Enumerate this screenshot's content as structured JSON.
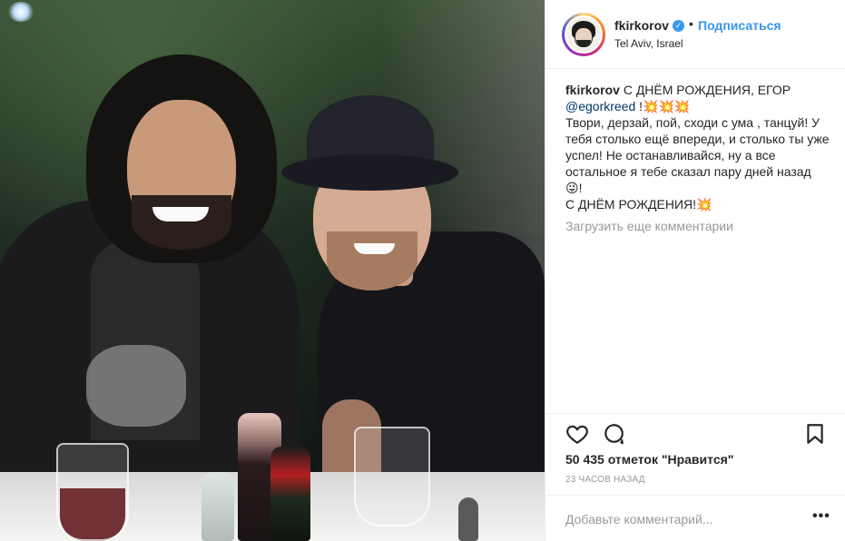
{
  "post": {
    "image_alt": "Two men posing at a table",
    "username": "fkirkorov",
    "follow_label": "Подписаться",
    "location": "Tel Aviv, Israel",
    "caption": {
      "username": "fkirkorov",
      "line1": "С ДНЁМ РОЖДЕНИЯ, ЕГОР",
      "mention": "@egorkreed",
      "line2_suffix": " !💥💥💥",
      "body": "Твори, дерзай, пой, сходи с ума , танцуй! У тебя столько ещё впереди, и столько ты уже успел! Не останавливайся, ну а все остальное я тебе сказал пару дней назад",
      "emoji_suffix": "😜!",
      "closing": "С ДНЁМ РОЖДЕНИЯ!💥"
    },
    "load_more_label": "Загрузить еще комментарии",
    "likes_text": "50 435 отметок \"Нравится\"",
    "time_text": "23 ЧАСОВ НАЗАД",
    "comment_placeholder": "Добавьте комментарий...",
    "more_label": "•••"
  },
  "icons": {
    "heart": "heart-icon",
    "comment": "comment-icon",
    "bookmark": "bookmark-icon",
    "verified": "verified-badge-icon",
    "more": "more-options-icon"
  },
  "colors": {
    "link_blue": "#3897f0",
    "mention_blue": "#003569",
    "muted": "#999999",
    "border": "#efefef",
    "text": "#262626"
  }
}
